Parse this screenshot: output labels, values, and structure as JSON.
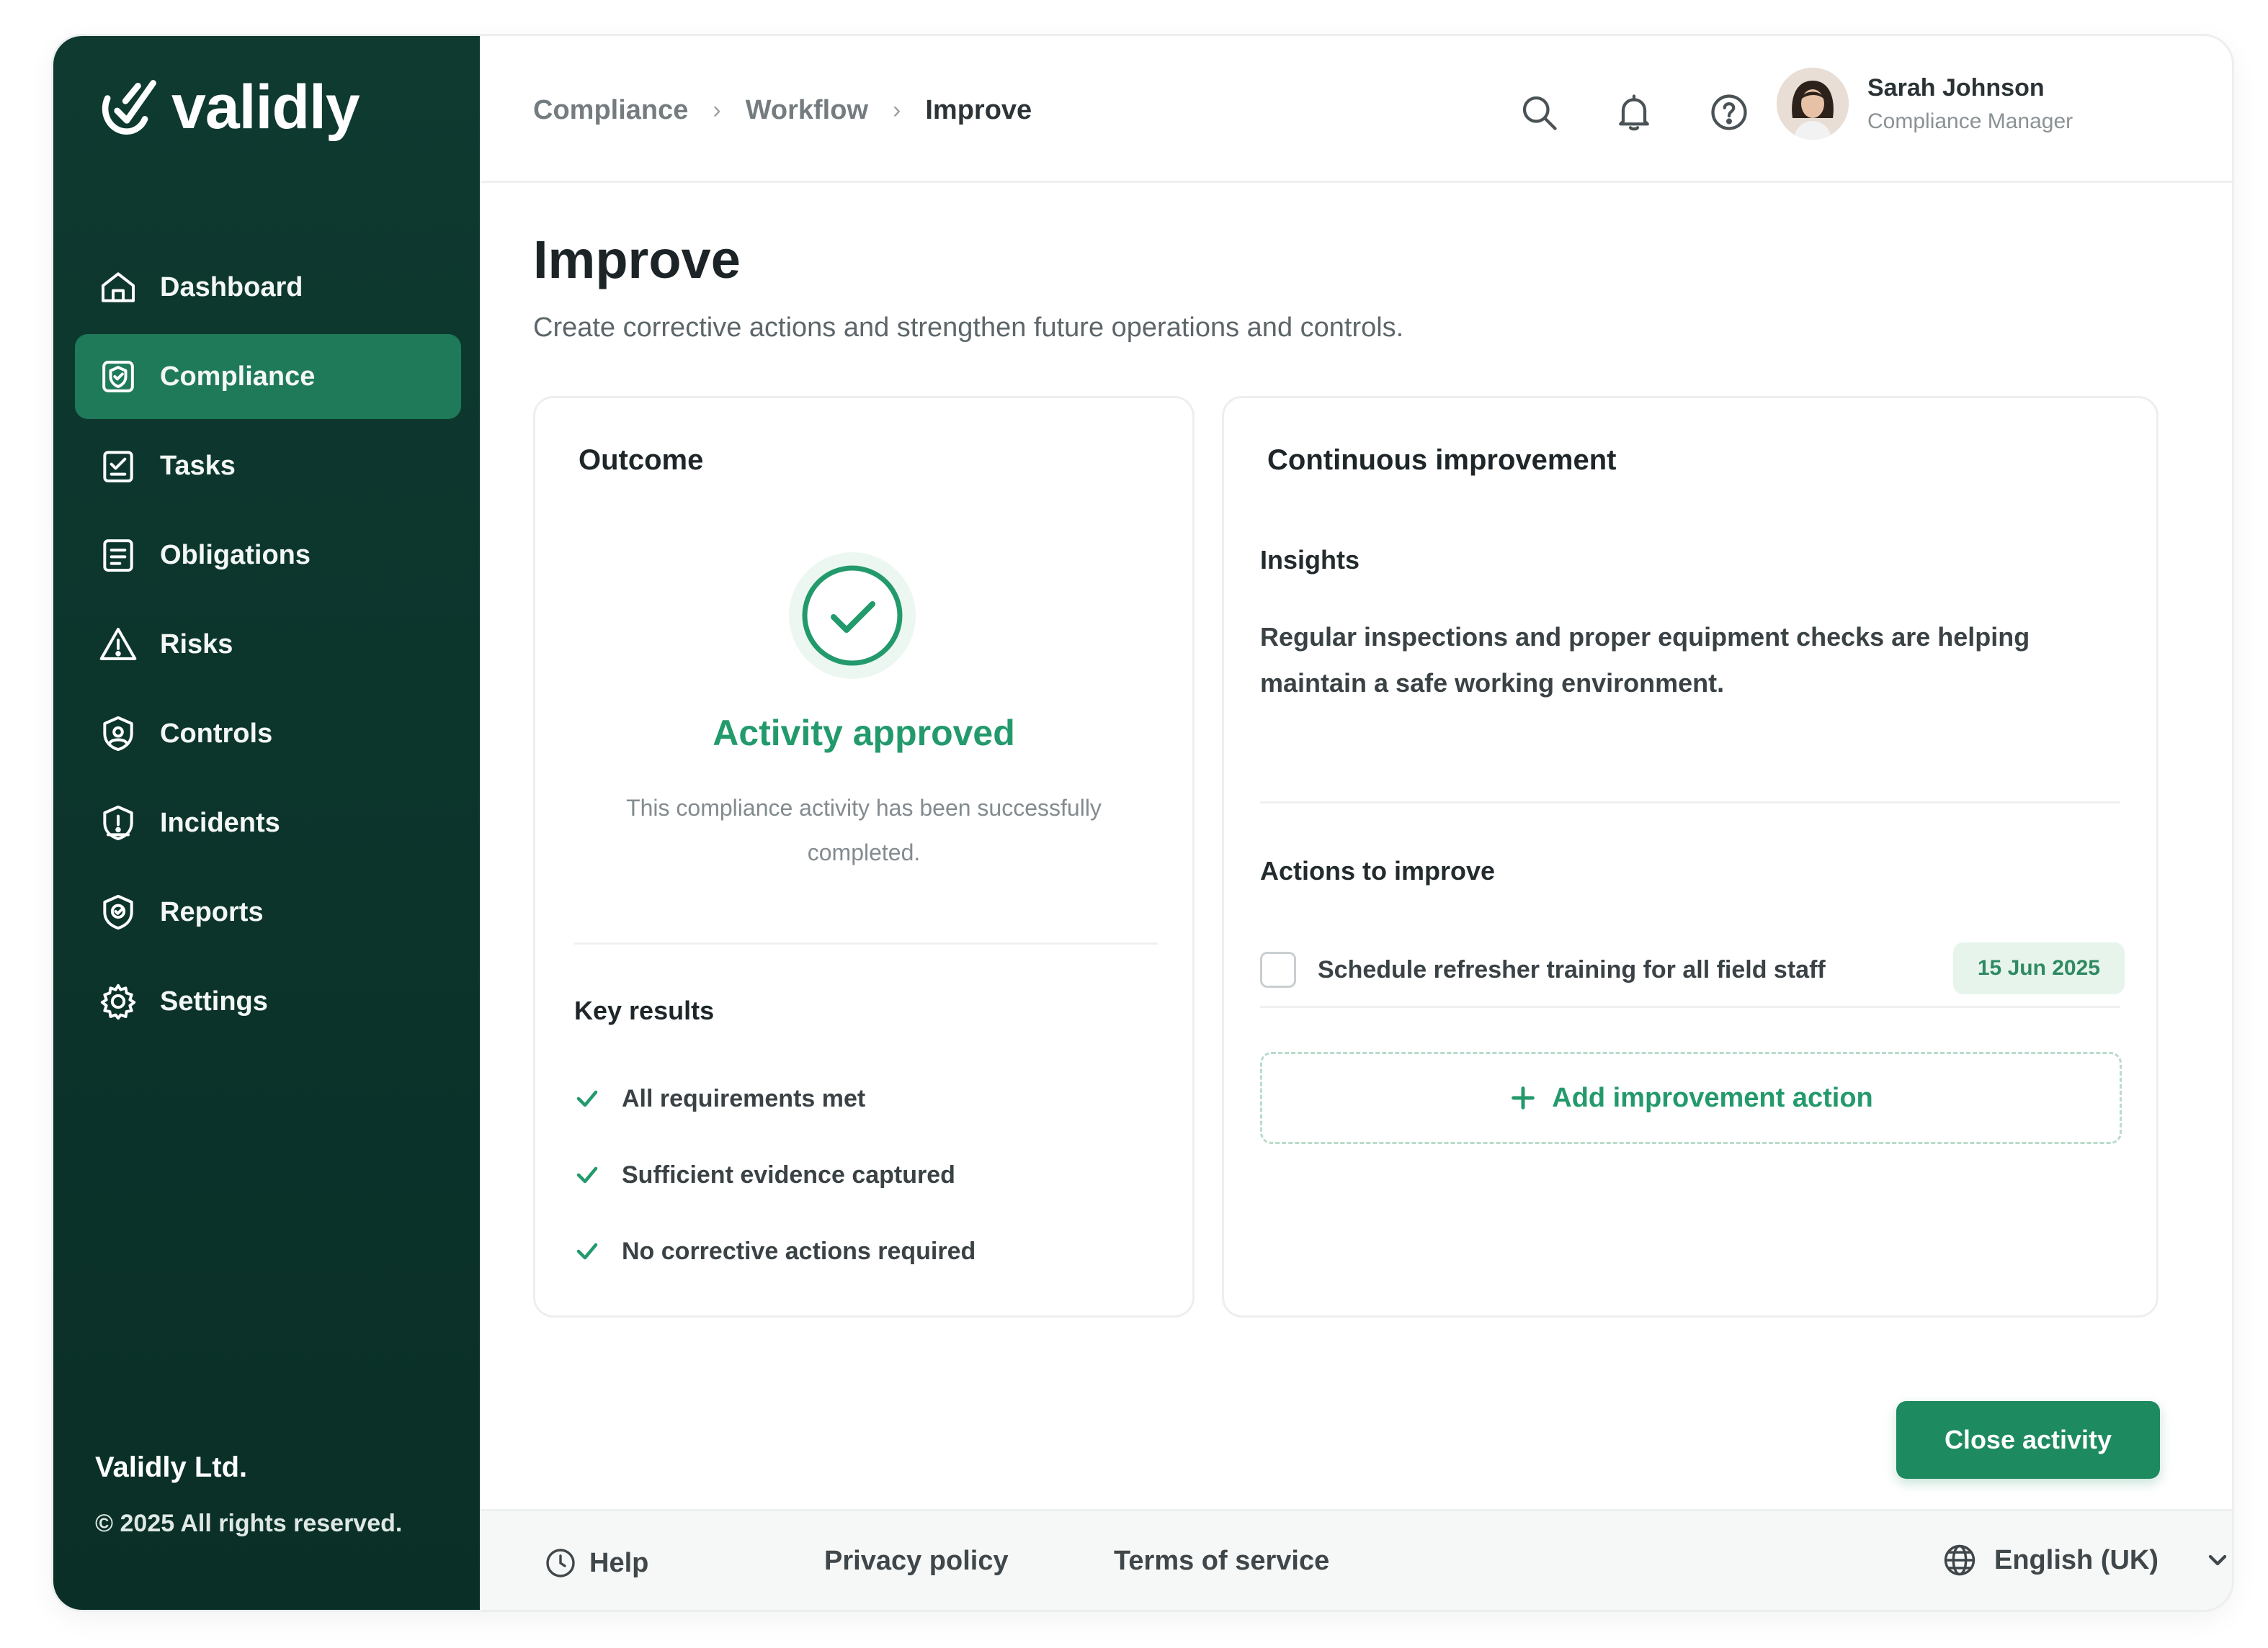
{
  "app": {
    "name": "validly"
  },
  "colors": {
    "sidebar": "#0e3a30",
    "active": "#1f7a5a",
    "accent": "#239a6c",
    "button": "#1e8a60"
  },
  "sidebar": {
    "items": [
      {
        "label": "Dashboard",
        "icon": "home-icon"
      },
      {
        "label": "Compliance",
        "icon": "compliance-icon",
        "active": true
      },
      {
        "label": "Tasks",
        "icon": "tasks-icon"
      },
      {
        "label": "Obligations",
        "icon": "obligations-icon"
      },
      {
        "label": "Risks",
        "icon": "warning-icon"
      },
      {
        "label": "Controls",
        "icon": "controls-icon"
      },
      {
        "label": "Incidents",
        "icon": "incidents-icon"
      },
      {
        "label": "Reports",
        "icon": "reports-icon"
      },
      {
        "label": "Settings",
        "icon": "gear-icon"
      }
    ],
    "company": "Validly Ltd.",
    "copyright": "© 2025 All rights reserved."
  },
  "header": {
    "breadcrumb": [
      "Compliance",
      "Workflow",
      "Improve"
    ],
    "user": {
      "name": "Sarah Johnson",
      "role": "Compliance Manager"
    }
  },
  "page": {
    "title": "Improve",
    "subtitle": "Create corrective actions and strengthen future operations and controls."
  },
  "outcome": {
    "heading": "Outcome",
    "status_title": "Activity approved",
    "status_text": "This compliance activity has been successfully completed.",
    "key_results_heading": "Key results",
    "key_results": [
      "All requirements met",
      "Sufficient evidence captured",
      "No corrective actions required"
    ]
  },
  "continuous_improvement": {
    "heading": "Continuous improvement",
    "insights_heading": "Insights",
    "insights_text": "Regular inspections and proper equipment checks are helping maintain a safe working environment.",
    "actions_heading": "Actions to improve",
    "actions": [
      {
        "label": "Schedule refresher training for all field staff",
        "date": "15 Jun 2025",
        "checked": false
      }
    ],
    "add_action_label": "Add improvement action"
  },
  "buttons": {
    "close_activity": "Close activity"
  },
  "footer": {
    "help": "Help",
    "privacy": "Privacy policy",
    "terms": "Terms of service",
    "language": "English (UK)"
  }
}
